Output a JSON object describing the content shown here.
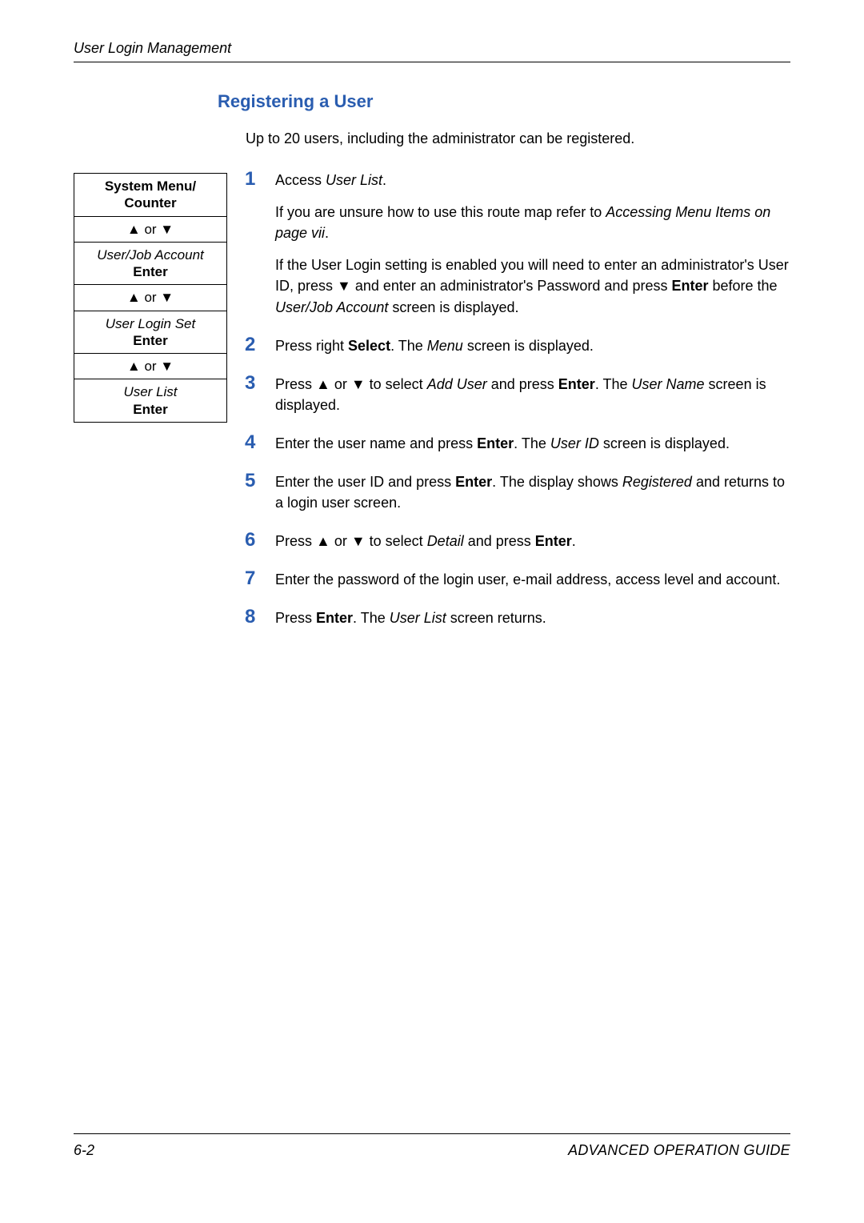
{
  "header": {
    "chapter": "User Login Management"
  },
  "section": {
    "title": "Registering a User",
    "intro": "Up to 20 users, including the administrator can be registered."
  },
  "nav": {
    "r1_line1": "System Menu/",
    "r1_line2": "Counter",
    "arrow_or": "▲ or ▼",
    "r3_line1": "User/Job Account",
    "enter": "Enter",
    "r5_line1": "User Login Set",
    "r7_line1": "User List"
  },
  "steps": [
    {
      "paras": [
        [
          {
            "t": "Access "
          },
          {
            "t": "User List",
            "cls": "i"
          },
          {
            "t": "."
          }
        ],
        [
          {
            "t": "If you are unsure how to use this route map refer to "
          },
          {
            "t": "Accessing Menu Items on page vii",
            "cls": "i"
          },
          {
            "t": "."
          }
        ],
        [
          {
            "t": "If the User Login setting is enabled you will need to enter an administrator's User ID, press ▼ and enter an administrator's Password and press "
          },
          {
            "t": "Enter",
            "cls": "b"
          },
          {
            "t": " before the "
          },
          {
            "t": "User/Job Account",
            "cls": "i"
          },
          {
            "t": " screen is displayed."
          }
        ]
      ]
    },
    {
      "paras": [
        [
          {
            "t": "Press right "
          },
          {
            "t": "Select",
            "cls": "b"
          },
          {
            "t": ". The "
          },
          {
            "t": "Menu",
            "cls": "i"
          },
          {
            "t": " screen is displayed."
          }
        ]
      ]
    },
    {
      "paras": [
        [
          {
            "t": "Press ▲ or ▼ to select "
          },
          {
            "t": "Add User",
            "cls": "i"
          },
          {
            "t": " and press "
          },
          {
            "t": "Enter",
            "cls": "b"
          },
          {
            "t": ". The "
          },
          {
            "t": "User Name",
            "cls": "i"
          },
          {
            "t": " screen is displayed."
          }
        ]
      ]
    },
    {
      "paras": [
        [
          {
            "t": "Enter the user name and press "
          },
          {
            "t": "Enter",
            "cls": "b"
          },
          {
            "t": ". The "
          },
          {
            "t": "User ID",
            "cls": "i"
          },
          {
            "t": " screen is displayed."
          }
        ]
      ]
    },
    {
      "paras": [
        [
          {
            "t": "Enter the user ID and press "
          },
          {
            "t": "Enter",
            "cls": "b"
          },
          {
            "t": ". The display shows "
          },
          {
            "t": "Registered",
            "cls": "i"
          },
          {
            "t": " and returns to a login user screen."
          }
        ]
      ]
    },
    {
      "paras": [
        [
          {
            "t": "Press ▲ or ▼ to select "
          },
          {
            "t": "Detail",
            "cls": "i"
          },
          {
            "t": " and press "
          },
          {
            "t": "Enter",
            "cls": "b"
          },
          {
            "t": "."
          }
        ]
      ]
    },
    {
      "paras": [
        [
          {
            "t": "Enter the password of the login user, e-mail address, access level and account."
          }
        ]
      ]
    },
    {
      "paras": [
        [
          {
            "t": "Press "
          },
          {
            "t": "Enter",
            "cls": "b"
          },
          {
            "t": ". The "
          },
          {
            "t": "User List",
            "cls": "i"
          },
          {
            "t": " screen returns."
          }
        ]
      ]
    }
  ],
  "footer": {
    "page": "6-2",
    "guide": "ADVANCED OPERATION GUIDE"
  }
}
